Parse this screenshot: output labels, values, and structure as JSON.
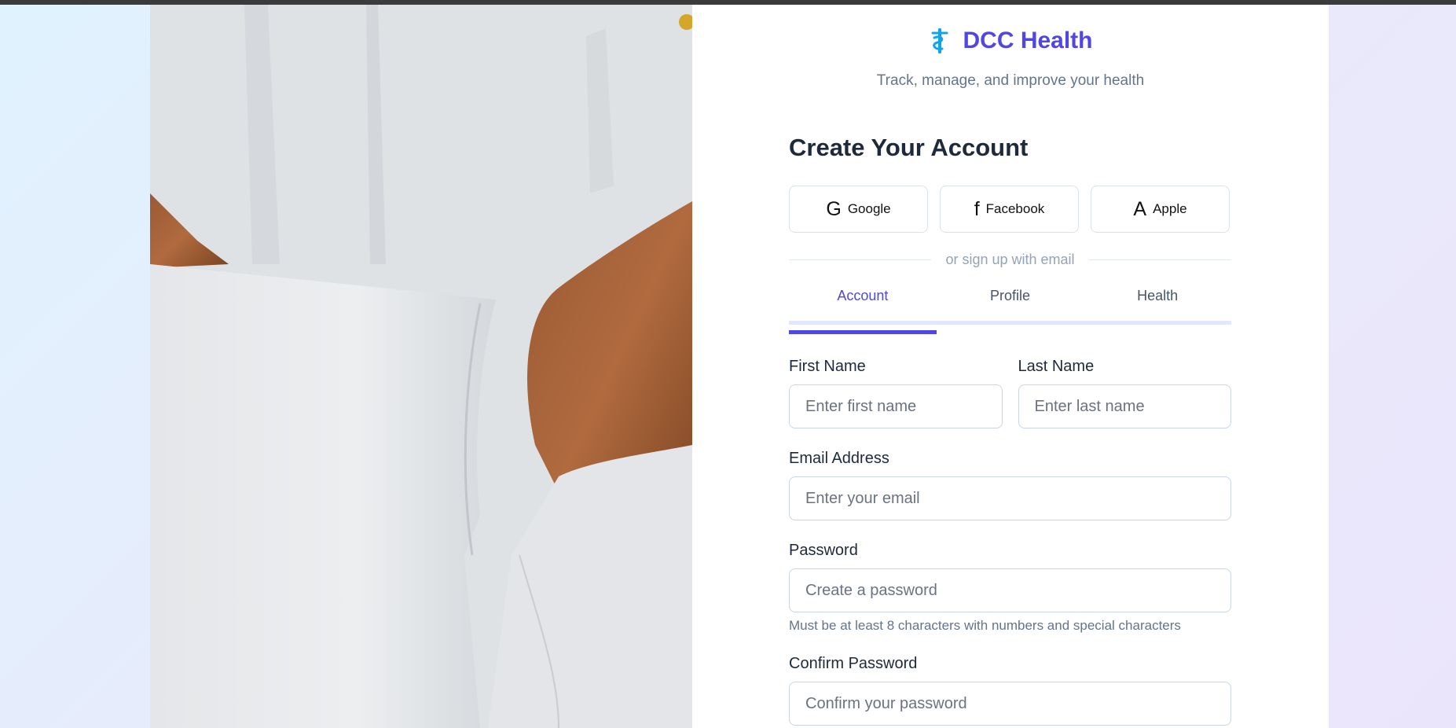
{
  "brand": {
    "name": "DCC Health",
    "tagline": "Track, manage, and improve your health",
    "icon": "caduceus-icon",
    "color": "#4f46e5"
  },
  "form": {
    "heading": "Create Your Account",
    "social": [
      {
        "glyph": "G",
        "label": "Google",
        "icon": "google-icon"
      },
      {
        "glyph": "f",
        "label": "Facebook",
        "icon": "facebook-icon"
      },
      {
        "glyph": "A",
        "label": "Apple",
        "icon": "apple-icon"
      }
    ],
    "divider_text": "or sign up with email",
    "tabs": [
      {
        "label": "Account",
        "active": true
      },
      {
        "label": "Profile",
        "active": false
      },
      {
        "label": "Health",
        "active": false
      }
    ],
    "first_name": {
      "label": "First Name",
      "placeholder": "Enter first name",
      "value": ""
    },
    "last_name": {
      "label": "Last Name",
      "placeholder": "Enter last name",
      "value": ""
    },
    "email": {
      "label": "Email Address",
      "placeholder": "Enter your email",
      "value": ""
    },
    "password": {
      "label": "Password",
      "placeholder": "Create a password",
      "value": "",
      "hint": "Must be at least 8 characters with numbers and special characters"
    },
    "confirm_password": {
      "label": "Confirm Password",
      "placeholder": "Confirm your password",
      "value": ""
    }
  },
  "colors": {
    "accent": "#4f46e5",
    "icon_accent": "#0ea5e9",
    "text_dark": "#1e293b",
    "text_muted": "#64748b"
  }
}
